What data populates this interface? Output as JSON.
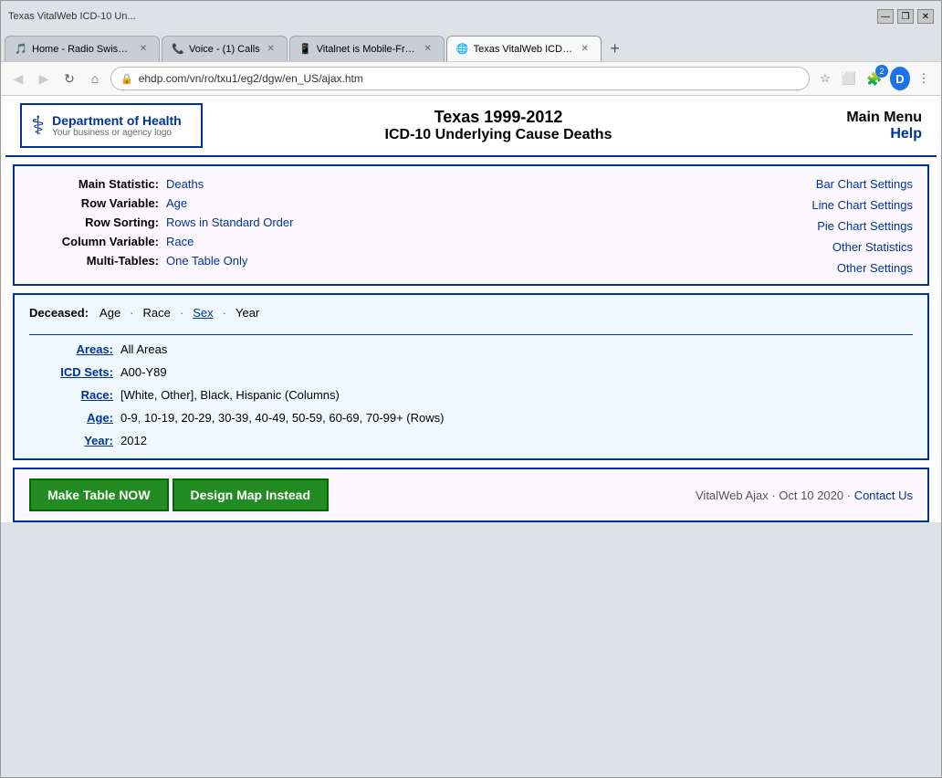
{
  "browser": {
    "tabs": [
      {
        "id": "tab1",
        "label": "Home - Radio Swiss Classic",
        "active": false,
        "icon": "🎵"
      },
      {
        "id": "tab2",
        "label": "Voice - (1) Calls",
        "active": false,
        "icon": "📞"
      },
      {
        "id": "tab3",
        "label": "Vitalnet is Mobile-Friendly",
        "active": false,
        "icon": "📱"
      },
      {
        "id": "tab4",
        "label": "Texas VitalWeb ICD-10 Un...",
        "active": true,
        "icon": "🌐"
      }
    ],
    "address": "ehdp.com/vn/ro/txu1/eg2/dgw/en_US/ajax.htm"
  },
  "header": {
    "logo_name": "Department of Health",
    "logo_sub": "Your business or agency logo",
    "title_line1": "Texas 1999-2012",
    "title_line2": "ICD-10 Underlying Cause Deaths",
    "main_menu": "Main Menu",
    "help": "Help"
  },
  "settings": {
    "rows": [
      {
        "label": "Main Statistic:",
        "value": "Deaths",
        "link": true
      },
      {
        "label": "Row Variable:",
        "value": "Age",
        "link": true
      },
      {
        "label": "Row Sorting:",
        "value": "Rows in Standard Order",
        "link": true
      },
      {
        "label": "Column Variable:",
        "value": "Race",
        "link": true
      },
      {
        "label": "Multi-Tables:",
        "value": "One Table Only",
        "link": true
      }
    ],
    "right_links": [
      {
        "label": "Bar Chart Settings",
        "link": true
      },
      {
        "label": "Line Chart Settings",
        "link": true
      },
      {
        "label": "Pie Chart Settings",
        "link": true
      },
      {
        "label": "Other Statistics",
        "link": true
      },
      {
        "label": "Other Settings",
        "link": true
      }
    ]
  },
  "data_panel": {
    "deceased_label": "Deceased:",
    "deceased_items": [
      {
        "text": "Age",
        "link": false
      },
      {
        "sep": "·"
      },
      {
        "text": "Race",
        "link": false
      },
      {
        "sep": "·"
      },
      {
        "text": "Sex",
        "link": true
      },
      {
        "sep": "·"
      },
      {
        "text": "Year",
        "link": false
      }
    ],
    "rows": [
      {
        "label": "Areas:",
        "value": "All Areas"
      },
      {
        "label": "ICD Sets:",
        "value": "A00-Y89"
      },
      {
        "label": "Race:",
        "value": "[White, Other], Black, Hispanic (Columns)"
      },
      {
        "label": "Age:",
        "value": "0-9, 10-19, 20-29, 30-39, 40-49, 50-59, 60-69, 70-99+ (Rows)"
      },
      {
        "label": "Year:",
        "value": "2012"
      }
    ]
  },
  "footer": {
    "btn_make_table": "Make Table NOW",
    "btn_design_map": "Design Map Instead",
    "info_text": "VitalWeb Ajax · Oct 10 2020 ·",
    "contact_us": "Contact Us"
  }
}
